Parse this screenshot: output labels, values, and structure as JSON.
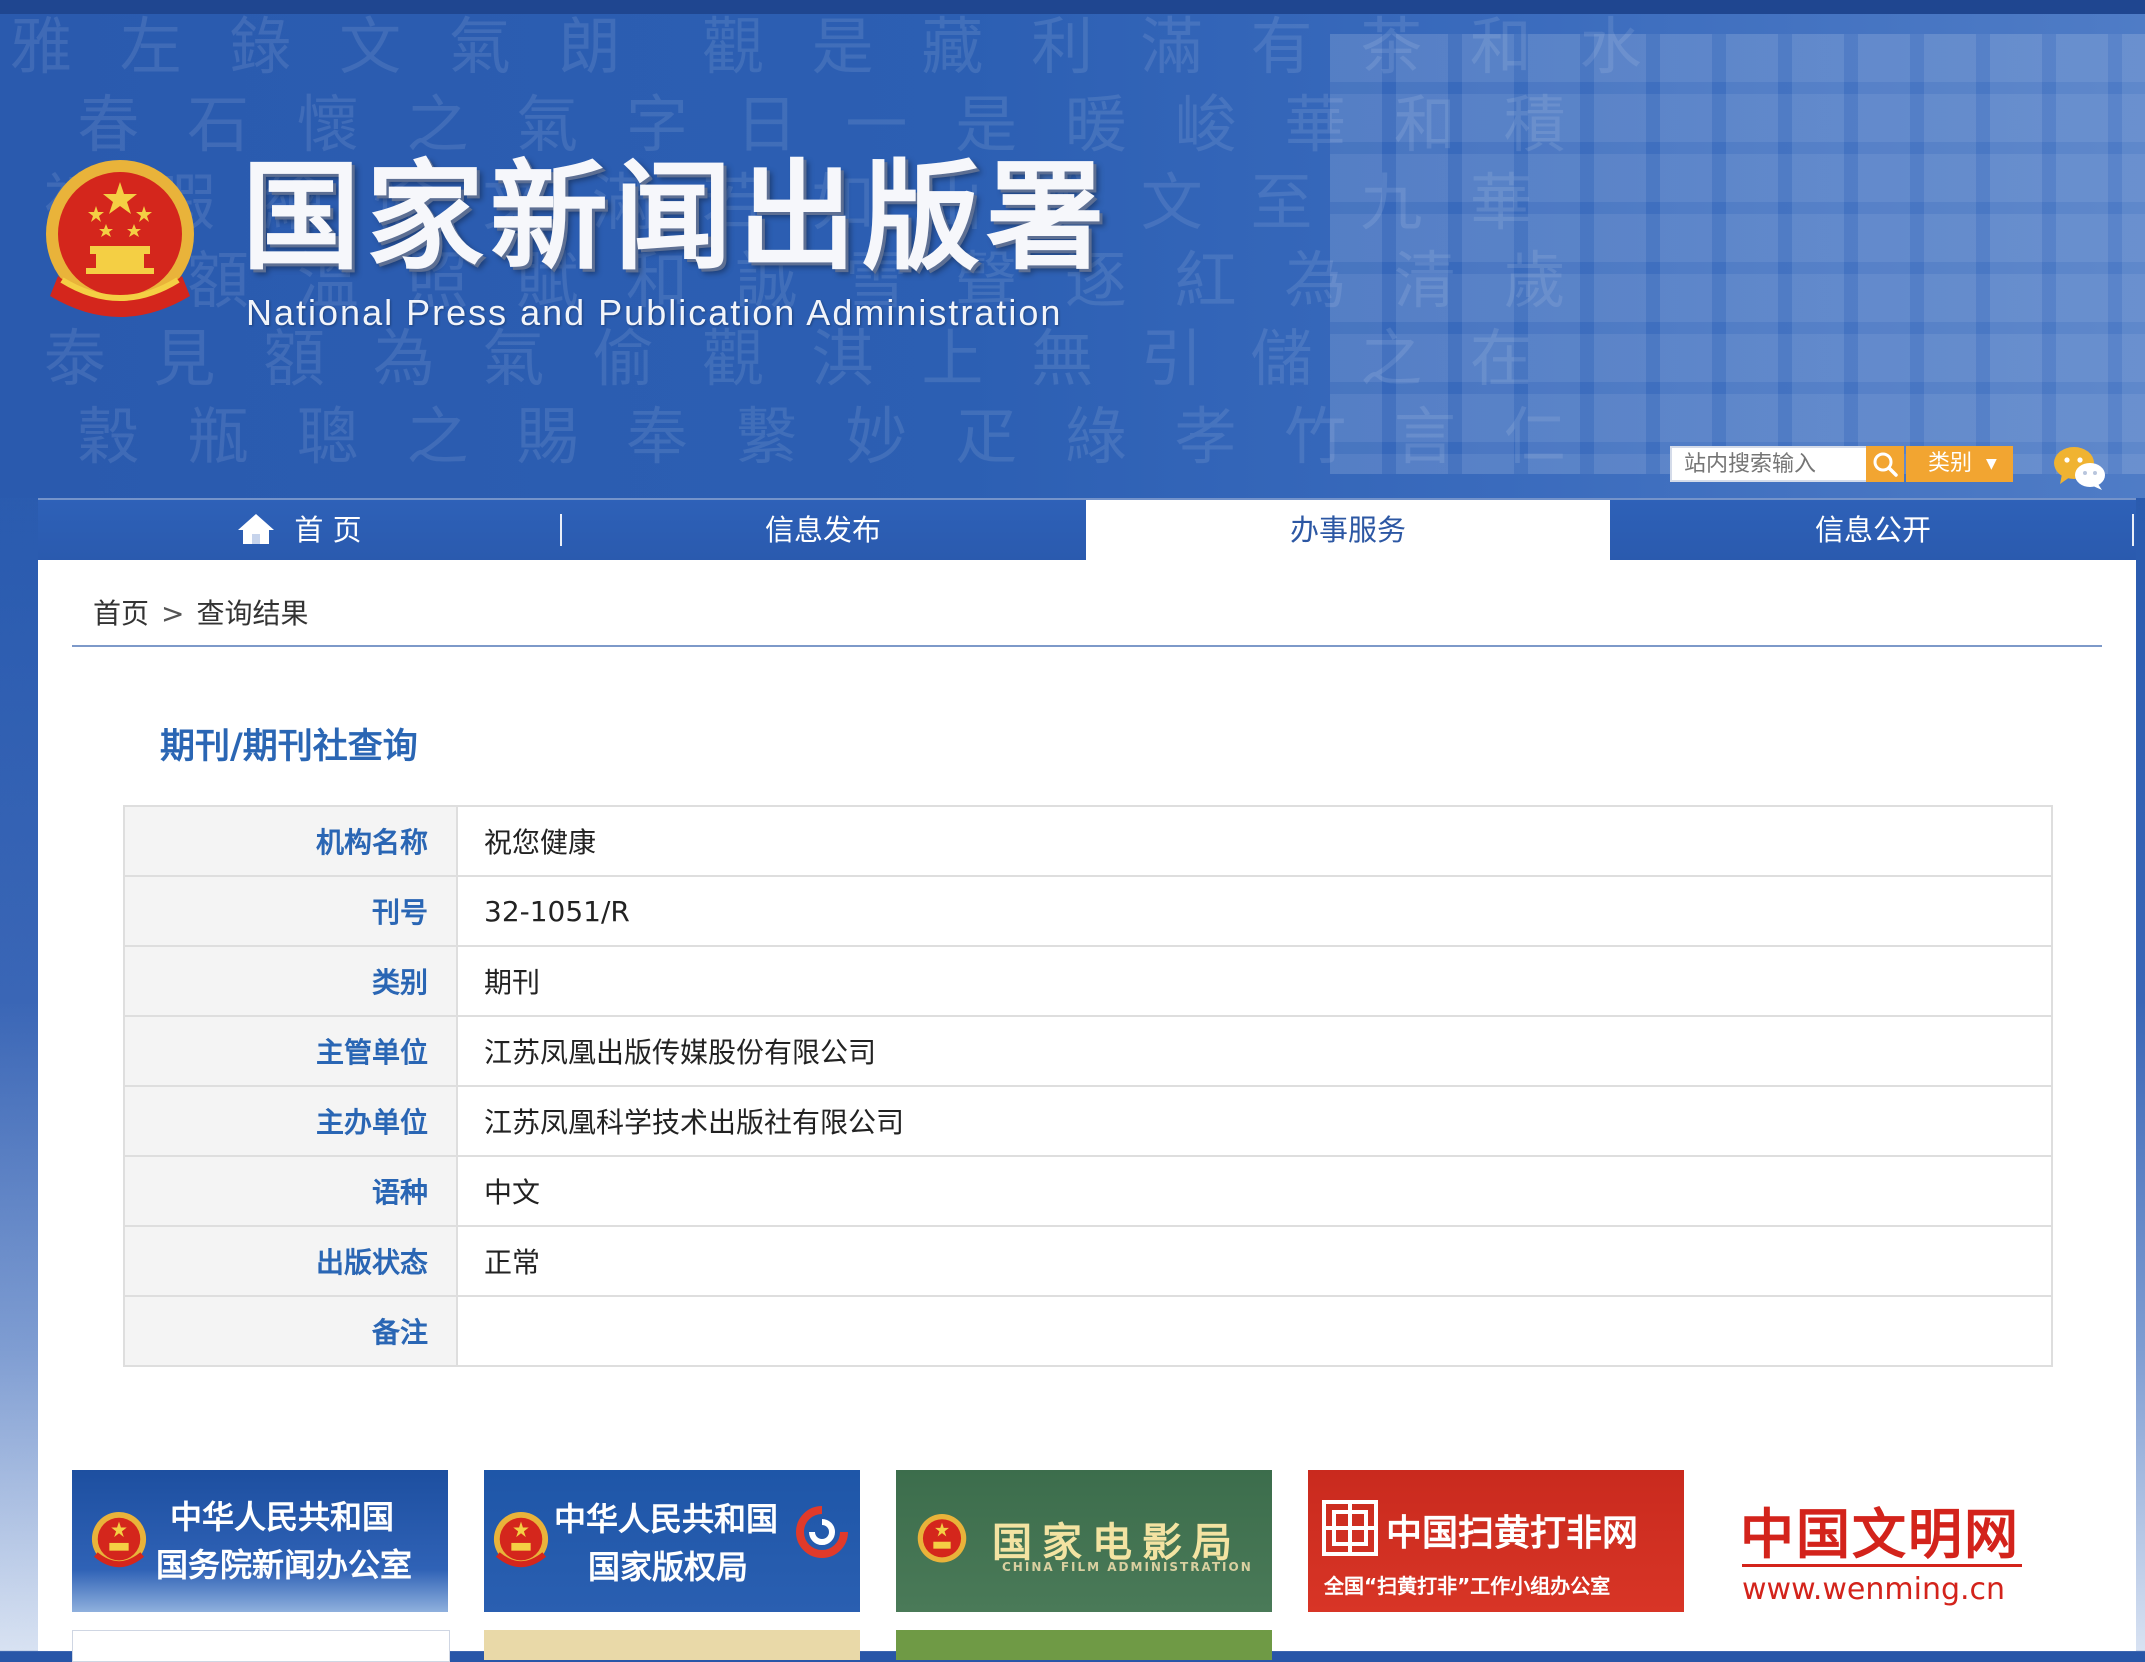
{
  "header": {
    "site_title": "国家新闻出版署",
    "site_subtitle": "National  Press and Publication Administration",
    "search_placeholder": "站内搜索输入",
    "category_label": "类别",
    "category_arrow": "▼"
  },
  "nav": {
    "items": [
      {
        "label": "首 页"
      },
      {
        "label": "信息发布"
      },
      {
        "label": "办事服务"
      },
      {
        "label": "信息公开"
      }
    ],
    "active_index": 2
  },
  "breadcrumb": {
    "home": "首页",
    "separator": ">",
    "current": "查询结果"
  },
  "result": {
    "title": "期刊/期刊社查询",
    "rows": [
      {
        "key": "机构名称",
        "value": "祝您健康"
      },
      {
        "key": "刊号",
        "value": "32-1051/R"
      },
      {
        "key": "类别",
        "value": "期刊"
      },
      {
        "key": "主管单位",
        "value": "江苏凤凰出版传媒股份有限公司"
      },
      {
        "key": "主办单位",
        "value": "江苏凤凰科学技术出版社有限公司"
      },
      {
        "key": "语种",
        "value": "中文"
      },
      {
        "key": "出版状态",
        "value": "正常"
      },
      {
        "key": "备注",
        "value": ""
      }
    ]
  },
  "partners": [
    {
      "line1": "中华人民共和国",
      "line2": "国务院新闻办公室"
    },
    {
      "line1": "中华人民共和国",
      "line2": "国家版权局"
    },
    {
      "line1": "国家电影局",
      "line2": "CHINA FILM ADMINISTRATION"
    },
    {
      "line1": "中国扫黄打非网",
      "line2": "全国“扫黄打非”工作小组办公室"
    },
    {
      "line1": "中国文明网",
      "line2": "www.wenming.cn"
    }
  ],
  "colors": {
    "brand_blue": "#2a5aae",
    "title_blue": "#2a66b4",
    "search_orange": "#f2a531",
    "partner_red": "#d3231b"
  }
}
